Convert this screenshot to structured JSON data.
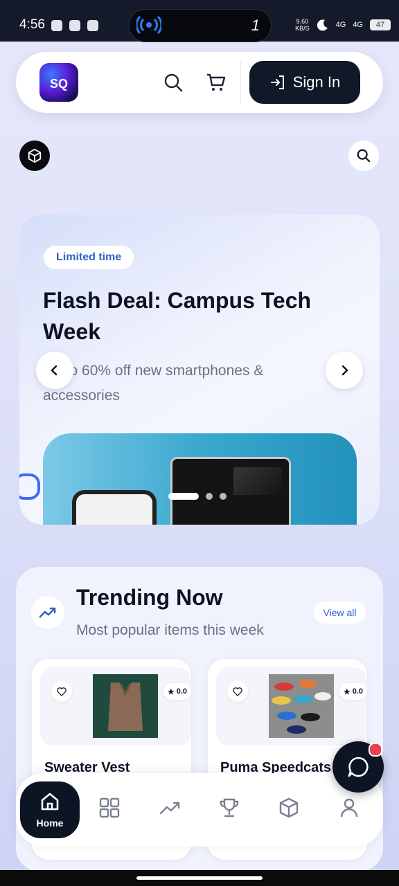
{
  "status_bar": {
    "time": "4:56",
    "island_number": "1",
    "net_speed_top": "9.60",
    "net_speed_unit": "KB/S",
    "signal_1": "4G",
    "signal_2": "4G",
    "battery": "47"
  },
  "header": {
    "logo_text": "SQ",
    "sign_in_label": "Sign In"
  },
  "hero": {
    "badge": "Limited time",
    "title": "Flash Deal: Campus Tech Week",
    "subtitle": "Up to 60% off new smartphones & accessories",
    "slide_count": 3,
    "active_slide": 0
  },
  "trending": {
    "title": "Trending Now",
    "subtitle": "Most popular items this week",
    "view_all": "View all",
    "products": [
      {
        "name": "Sweater Vest",
        "rating": "0.0"
      },
      {
        "name": "Puma Speedcats",
        "rating": "0.0"
      }
    ]
  },
  "nav": {
    "home_label": "Home",
    "items": [
      "home",
      "categories",
      "trending",
      "leaderboard",
      "orders",
      "profile"
    ]
  },
  "colors": {
    "accent": "#2d62c5",
    "dark": "#0d1424",
    "notification": "#ef3f4f"
  }
}
